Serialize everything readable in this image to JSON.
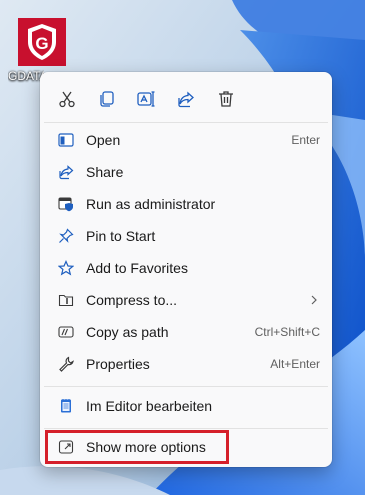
{
  "desktop": {
    "icon_label": "GDATA",
    "logo_icon": "gdata-shield-icon",
    "accent_color": "#c8102e"
  },
  "toolbar": {
    "icons": [
      "cut-icon",
      "copy-icon",
      "rename-icon",
      "share-icon",
      "delete-icon"
    ]
  },
  "menu": {
    "items": [
      {
        "label": "Open",
        "shortcut": "Enter",
        "icon": "open-icon"
      },
      {
        "label": "Share",
        "shortcut": "",
        "icon": "share-icon"
      },
      {
        "label": "Run as administrator",
        "shortcut": "",
        "icon": "shield-window-icon"
      },
      {
        "label": "Pin to Start",
        "shortcut": "",
        "icon": "pin-icon"
      },
      {
        "label": "Add to Favorites",
        "shortcut": "",
        "icon": "star-icon"
      },
      {
        "label": "Compress to...",
        "shortcut": "",
        "icon": "zip-folder-icon",
        "submenu": true
      },
      {
        "label": "Copy as path",
        "shortcut": "Ctrl+Shift+C",
        "icon": "path-icon"
      },
      {
        "label": "Properties",
        "shortcut": "Alt+Enter",
        "icon": "wrench-icon"
      }
    ],
    "editor_item": {
      "label": "Im Editor bearbeiten",
      "icon": "notepad-icon"
    },
    "more_options": {
      "label": "Show more options",
      "icon": "more-options-icon"
    }
  },
  "highlight_color": "#d51f2a"
}
